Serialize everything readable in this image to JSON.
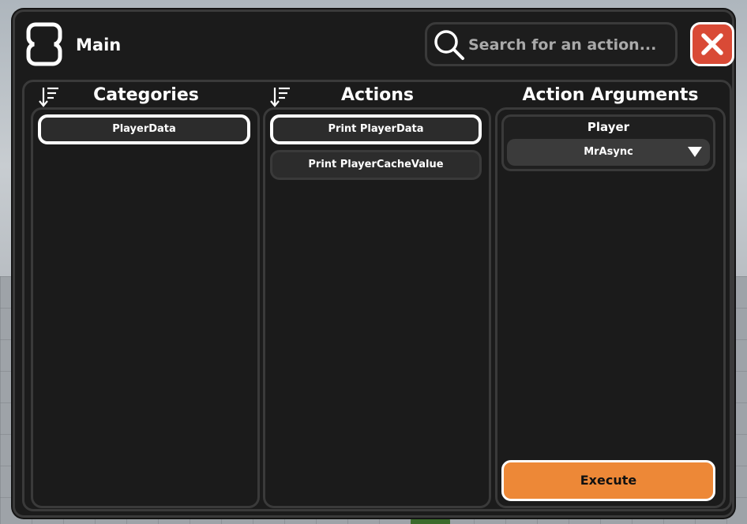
{
  "window": {
    "title": "Main",
    "logo_icon": "pill-logo-icon",
    "close_icon": "close-icon",
    "colors": {
      "background": "#1b1b1b",
      "border": "#3a3a3a",
      "close": "#d94a36",
      "accent": "#ed8837"
    }
  },
  "search": {
    "placeholder": "Search for an action...",
    "value": "",
    "icon": "search-icon"
  },
  "categories": {
    "heading": "Categories",
    "sort_icon": "sort-descending-icon",
    "items": [
      {
        "label": "PlayerData",
        "selected": true
      }
    ]
  },
  "actions": {
    "heading": "Actions",
    "sort_icon": "sort-descending-icon",
    "items": [
      {
        "label": "Print PlayerData",
        "selected": true
      },
      {
        "label": "Print PlayerCacheValue",
        "selected": false
      }
    ]
  },
  "arguments": {
    "heading": "Action Arguments",
    "fields": [
      {
        "label": "Player",
        "value": "MrAsync",
        "type": "dropdown"
      }
    ],
    "execute_label": "Execute"
  }
}
